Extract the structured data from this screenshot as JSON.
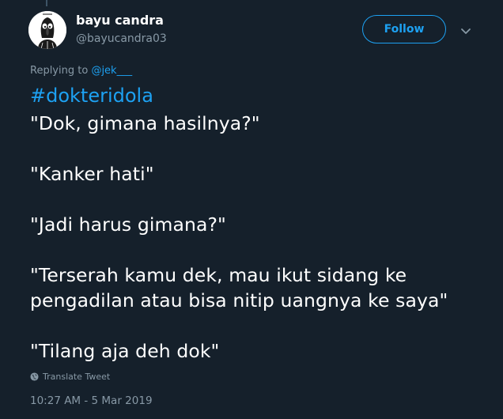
{
  "colors": {
    "background": "#15202b",
    "primary_text": "#ffffff",
    "secondary_text": "#8899a6",
    "accent": "#1da1f2"
  },
  "author": {
    "display_name": "bayu candra",
    "handle": "@bayucandra03",
    "avatar_icon": "squidward-avatar"
  },
  "follow_button": {
    "label": "Follow"
  },
  "menu": {
    "icon": "chevron-down-icon"
  },
  "reply_context": {
    "prefix": "Replying to",
    "mention": "@jek___"
  },
  "tweet": {
    "hashtag": "#dokteridola",
    "lines": [
      "\"Dok, gimana hasilnya?\"",
      "\"Kanker hati\"",
      "\"Jadi harus gimana?\"",
      "\"Terserah kamu dek, mau ikut sidang ke",
      "pengadilan atau bisa nitip uangnya ke saya\"",
      "\"Tilang aja deh dok\""
    ]
  },
  "translate": {
    "icon": "globe-icon",
    "label": "Translate Tweet"
  },
  "timestamp": "10:27 AM - 5 Mar 2019"
}
